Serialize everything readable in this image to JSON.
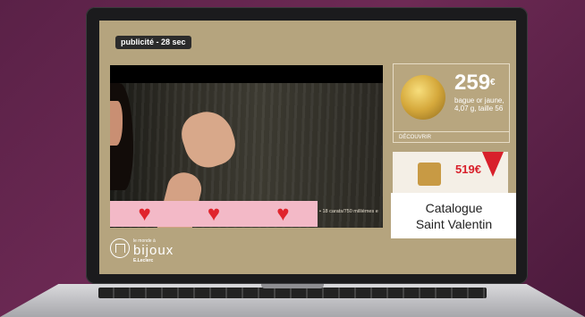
{
  "ad": {
    "label": "publicité - 28 sec"
  },
  "video": {
    "caption": "• 18 carats/750 millièmes e"
  },
  "sidebar": {
    "card1": {
      "price": "259",
      "currency": "€",
      "description": "bague or jaune, 4,07 g, taille 56",
      "cta": "DÉCOUVRIR"
    },
    "card2": {
      "price": "519",
      "currency": "€"
    },
    "catalog": {
      "line1": "Catalogue",
      "line2": "Saint Valentin"
    }
  },
  "brand": {
    "small": "le monde à",
    "main": "bijoux",
    "sub": "E.Leclerc"
  },
  "colors": {
    "screen_bg": "#b5a47e",
    "heart_band": "#f3b9c7",
    "heart": "#e0242d",
    "accent_red": "#d8202b"
  }
}
